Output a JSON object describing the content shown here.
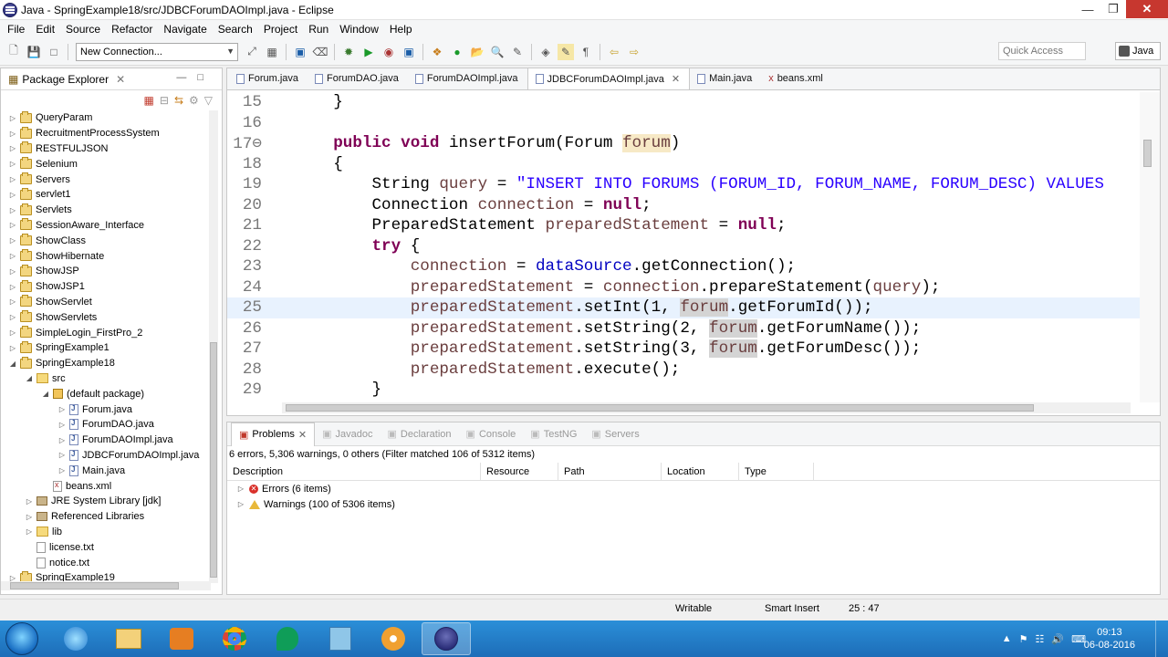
{
  "window": {
    "title": "Java - SpringExample18/src/JDBCForumDAOImpl.java - Eclipse"
  },
  "menu": [
    "File",
    "Edit",
    "Source",
    "Refactor",
    "Navigate",
    "Search",
    "Project",
    "Run",
    "Window",
    "Help"
  ],
  "toolbar": {
    "connection": "New Connection...",
    "quick_access": "Quick Access",
    "perspective": "Java"
  },
  "package_explorer": {
    "title": "Package Explorer",
    "items": [
      {
        "label": "QueryParam",
        "depth": 0,
        "type": "proj",
        "arrow": "▷"
      },
      {
        "label": "RecruitmentProcessSystem",
        "depth": 0,
        "type": "proj",
        "arrow": "▷"
      },
      {
        "label": "RESTFULJSON",
        "depth": 0,
        "type": "proj",
        "arrow": "▷"
      },
      {
        "label": "Selenium",
        "depth": 0,
        "type": "proj",
        "arrow": "▷"
      },
      {
        "label": "Servers",
        "depth": 0,
        "type": "proj",
        "arrow": "▷"
      },
      {
        "label": "servlet1",
        "depth": 0,
        "type": "proj",
        "arrow": "▷"
      },
      {
        "label": "Servlets",
        "depth": 0,
        "type": "proj",
        "arrow": "▷"
      },
      {
        "label": "SessionAware_Interface",
        "depth": 0,
        "type": "proj",
        "arrow": "▷"
      },
      {
        "label": "ShowClass",
        "depth": 0,
        "type": "proj",
        "arrow": "▷"
      },
      {
        "label": "ShowHibernate",
        "depth": 0,
        "type": "proj",
        "arrow": "▷"
      },
      {
        "label": "ShowJSP",
        "depth": 0,
        "type": "proj",
        "arrow": "▷"
      },
      {
        "label": "ShowJSP1",
        "depth": 0,
        "type": "proj",
        "arrow": "▷"
      },
      {
        "label": "ShowServlet",
        "depth": 0,
        "type": "proj",
        "arrow": "▷"
      },
      {
        "label": "ShowServlets",
        "depth": 0,
        "type": "proj",
        "arrow": "▷"
      },
      {
        "label": "SimpleLogin_FirstPro_2",
        "depth": 0,
        "type": "proj",
        "arrow": "▷"
      },
      {
        "label": "SpringExample1",
        "depth": 0,
        "type": "proj",
        "arrow": "▷"
      },
      {
        "label": "SpringExample18",
        "depth": 0,
        "type": "proj",
        "arrow": "◢"
      },
      {
        "label": "src",
        "depth": 1,
        "type": "folder",
        "arrow": "◢"
      },
      {
        "label": "(default package)",
        "depth": 2,
        "type": "pkg",
        "arrow": "◢"
      },
      {
        "label": "Forum.java",
        "depth": 3,
        "type": "jfile",
        "arrow": "▷"
      },
      {
        "label": "ForumDAO.java",
        "depth": 3,
        "type": "jfile",
        "arrow": "▷"
      },
      {
        "label": "ForumDAOImpl.java",
        "depth": 3,
        "type": "jfile",
        "arrow": "▷"
      },
      {
        "label": "JDBCForumDAOImpl.java",
        "depth": 3,
        "type": "jfile",
        "arrow": "▷"
      },
      {
        "label": "Main.java",
        "depth": 3,
        "type": "jfile",
        "arrow": "▷"
      },
      {
        "label": "beans.xml",
        "depth": 2,
        "type": "xfile",
        "arrow": ""
      },
      {
        "label": "JRE System Library [jdk]",
        "depth": 1,
        "type": "lib",
        "arrow": "▷"
      },
      {
        "label": "Referenced Libraries",
        "depth": 1,
        "type": "lib",
        "arrow": "▷"
      },
      {
        "label": "lib",
        "depth": 1,
        "type": "folder",
        "arrow": "▷"
      },
      {
        "label": "license.txt",
        "depth": 1,
        "type": "tfile",
        "arrow": ""
      },
      {
        "label": "notice.txt",
        "depth": 1,
        "type": "tfile",
        "arrow": ""
      },
      {
        "label": "SpringExample19",
        "depth": 0,
        "type": "proj",
        "arrow": "▷"
      }
    ]
  },
  "editor_tabs": [
    {
      "label": "Forum.java",
      "active": false
    },
    {
      "label": "ForumDAO.java",
      "active": false
    },
    {
      "label": "ForumDAOImpl.java",
      "active": false
    },
    {
      "label": "JDBCForumDAOImpl.java",
      "active": true
    },
    {
      "label": "Main.java",
      "active": false
    },
    {
      "label": "beans.xml",
      "active": false
    }
  ],
  "code_lines": [
    {
      "n": "15",
      "html": "    }"
    },
    {
      "n": "16",
      "html": ""
    },
    {
      "n": "17⊖",
      "html": "    <span class=\"kw\">public</span> <span class=\"kw\">void</span> insertForum(Forum <span class=\"var hlp\">forum</span>)"
    },
    {
      "n": "18",
      "html": "    {"
    },
    {
      "n": "19",
      "html": "        String <span class=\"var\">query</span> = <span class=\"str\">\"INSERT INTO FORUMS (FORUM_ID, FORUM_NAME, FORUM_DESC) VALUES</span>"
    },
    {
      "n": "20",
      "html": "        Connection <span class=\"var\">connection</span> = <span class=\"kw\">null</span>;"
    },
    {
      "n": "21",
      "html": "        PreparedStatement <span class=\"var\">preparedStatement</span> = <span class=\"kw\">null</span>;"
    },
    {
      "n": "22",
      "html": "        <span class=\"kw\">try</span> {"
    },
    {
      "n": "23",
      "html": "            <span class=\"var\">connection</span> = <span class=\"fld\">dataSource</span>.getConnection();"
    },
    {
      "n": "24",
      "html": "            <span class=\"var\">preparedStatement</span> = <span class=\"var\">connection</span>.prepareStatement(<span class=\"var\">query</span>);"
    },
    {
      "n": "25",
      "html": "            <span class=\"var\">preparedStatement</span>.setInt(1, <span class=\"var hl\">forum</span>.getForumId());",
      "cur": true
    },
    {
      "n": "26",
      "html": "            <span class=\"var\">preparedStatement</span>.setString(2, <span class=\"var hl\">forum</span>.getForumName());"
    },
    {
      "n": "27",
      "html": "            <span class=\"var\">preparedStatement</span>.setString(3, <span class=\"var hl\">forum</span>.getForumDesc());"
    },
    {
      "n": "28",
      "html": "            <span class=\"var\">preparedStatement</span>.execute();"
    },
    {
      "n": "29",
      "html": "        }"
    }
  ],
  "bottom_tabs": [
    {
      "label": "Problems",
      "active": true
    },
    {
      "label": "Javadoc",
      "active": false
    },
    {
      "label": "Declaration",
      "active": false
    },
    {
      "label": "Console",
      "active": false
    },
    {
      "label": "TestNG",
      "active": false
    },
    {
      "label": "Servers",
      "active": false
    }
  ],
  "problems": {
    "summary": "6 errors, 5,306 warnings, 0 others (Filter matched 106 of 5312 items)",
    "columns": [
      "Description",
      "Resource",
      "Path",
      "Location",
      "Type"
    ],
    "rows": [
      {
        "label": "Errors (6 items)",
        "kind": "error"
      },
      {
        "label": "Warnings (100 of 5306 items)",
        "kind": "warning"
      }
    ]
  },
  "status": {
    "writable": "Writable",
    "insert_mode": "Smart Insert",
    "position": "25 : 47"
  },
  "taskbar": {
    "time": "09:13",
    "date": "06-08-2016"
  }
}
